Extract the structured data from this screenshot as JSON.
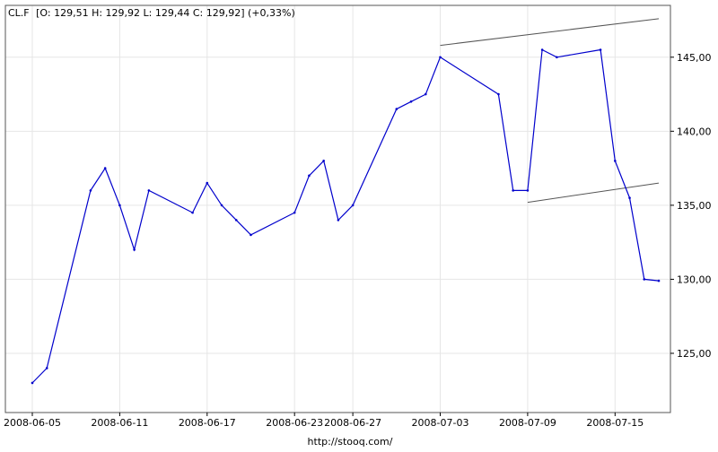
{
  "header": {
    "symbol": "CL.F",
    "ohlc_text": "[O: 129,51  H: 129,92  L: 129,44  C: 129,92] (+0,33%)"
  },
  "footer": {
    "source_url": "http://stooq.com/"
  },
  "colors": {
    "series": "#0000cc",
    "grid": "#e6e6e6",
    "trendline": "#555555",
    "frame": "#555555"
  },
  "chart_data": {
    "type": "line",
    "title": "CL.F [O: 129,51  H: 129,92  L: 129,44  C: 129,92] (+0,33%)",
    "xlabel": "",
    "ylabel": "",
    "ylim": [
      121,
      148.5
    ],
    "y_ticks": [
      125,
      130,
      135,
      140,
      145
    ],
    "y_tick_labels": [
      "125,00",
      "130,00",
      "135,00",
      "140,00",
      "145,00"
    ],
    "x_ticks": [
      "2008-06-05",
      "2008-06-11",
      "2008-06-17",
      "2008-06-23",
      "2008-06-27",
      "2008-07-03",
      "2008-07-09",
      "2008-07-15"
    ],
    "grid": true,
    "legend": "none",
    "series": [
      {
        "x": [
          "2008-06-05",
          "2008-06-06",
          "2008-06-09",
          "2008-06-10",
          "2008-06-11",
          "2008-06-12",
          "2008-06-13",
          "2008-06-16",
          "2008-06-17",
          "2008-06-18",
          "2008-06-19",
          "2008-06-20",
          "2008-06-23",
          "2008-06-24",
          "2008-06-25",
          "2008-06-26",
          "2008-06-27",
          "2008-06-30",
          "2008-07-01",
          "2008-07-02",
          "2008-07-03",
          "2008-07-07",
          "2008-07-08",
          "2008-07-09",
          "2008-07-10",
          "2008-07-11",
          "2008-07-14",
          "2008-07-15",
          "2008-07-16",
          "2008-07-17",
          "2008-07-18"
        ],
        "values": [
          123.0,
          124.0,
          136.0,
          137.5,
          135.0,
          132.0,
          136.0,
          134.5,
          136.5,
          135.0,
          134.0,
          133.0,
          134.5,
          137.0,
          138.0,
          134.0,
          135.0,
          141.5,
          142.0,
          142.5,
          145.0,
          142.5,
          136.0,
          136.0,
          145.5,
          145.0,
          145.5,
          138.0,
          135.5,
          130.0,
          129.9
        ]
      }
    ],
    "trendlines": [
      {
        "from": [
          "2008-07-03",
          145.8
        ],
        "to": [
          "2008-07-18",
          147.6
        ]
      },
      {
        "from": [
          "2008-07-09",
          135.2
        ],
        "to": [
          "2008-07-18",
          136.5
        ]
      }
    ]
  }
}
